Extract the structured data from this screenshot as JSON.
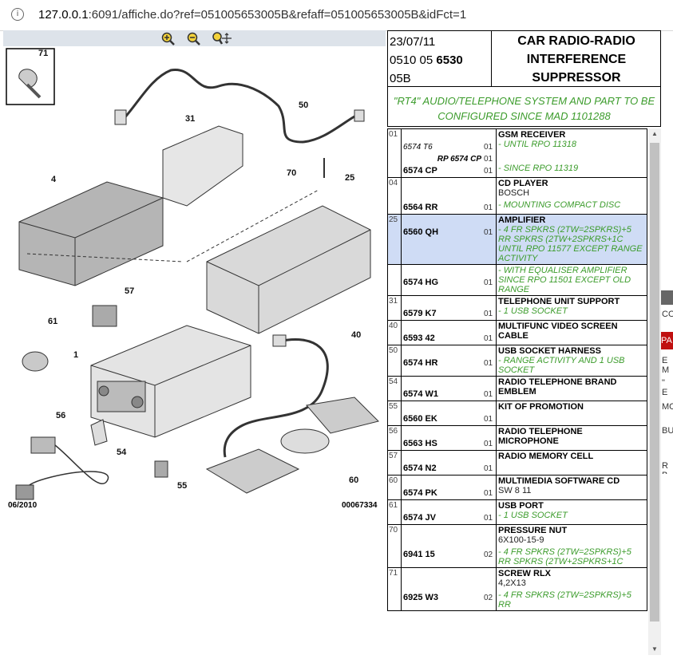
{
  "url": {
    "prefix": "127.0.0.1",
    "rest": ":6091/affiche.do?ref=051005653005B&refaff=051005653005B&idFct=1"
  },
  "header": {
    "date": "23/07/11",
    "code_a": "0510 05",
    "code_b": "6530",
    "code_c": "05B",
    "title": "CAR RADIO-RADIO INTERFERENCE SUPPRESSOR"
  },
  "config_note": "\"RT4\" AUDIO/TELEPHONE SYSTEM AND PART TO BE CONFIGURED SINCE MAD 1101288",
  "diagram": {
    "date": "06/2010",
    "ref": "00067334",
    "labels": [
      "71",
      "50",
      "31",
      "70",
      "25",
      "4",
      "57",
      "61",
      "40",
      "1",
      "56",
      "54",
      "55",
      "60"
    ]
  },
  "parts": [
    {
      "num": "01",
      "refs": [
        {
          "t": "6574 T6",
          "s": "it"
        },
        {
          "t": "RP 6574 CP",
          "s": "itb"
        },
        {
          "t": "6574 CP",
          "s": "b"
        }
      ],
      "qty": [
        "01",
        "01",
        "01"
      ],
      "name": "GSM RECEIVER",
      "lines": [
        {
          "t": "- UNTIL RPO 11318",
          "c": "g"
        },
        {
          "t": "",
          "c": "g"
        },
        {
          "t": "- SINCE RPO 11319",
          "c": "g"
        }
      ]
    },
    {
      "num": "04",
      "refs": [
        {
          "t": "6564 RR",
          "s": "b"
        }
      ],
      "qty": [
        "01"
      ],
      "name": "CD PLAYER",
      "lines": [
        {
          "t": "BOSCH",
          "c": "p"
        },
        {
          "t": "- MOUNTING COMPACT DISC",
          "c": "g"
        }
      ]
    },
    {
      "num": "25",
      "refs": [
        {
          "t": "6560 QH",
          "s": "b"
        }
      ],
      "qty": [
        "01"
      ],
      "name": "AMPLIFIER",
      "hl": true,
      "lines": [
        {
          "t": "- 4 FR SPKRS (2TW=2SPKRS)+5 RR SPKRS (2TW+2SPKRS+1C UNTIL RPO 11577 EXCEPT RANGE ACTIVITY",
          "c": "g"
        }
      ]
    },
    {
      "num": "",
      "refs": [
        {
          "t": "6574 HG",
          "s": "b"
        }
      ],
      "qty": [
        "01"
      ],
      "name": "",
      "lines": [
        {
          "t": "- WITH EQUALISER AMPLIFIER SINCE RPO 11501 EXCEPT OLD RANGE",
          "c": "g"
        }
      ]
    },
    {
      "num": "31",
      "refs": [
        {
          "t": "6579 K7",
          "s": "b"
        }
      ],
      "qty": [
        "01"
      ],
      "name": "TELEPHONE UNIT SUPPORT",
      "lines": [
        {
          "t": "- 1 USB SOCKET",
          "c": "g"
        }
      ]
    },
    {
      "num": "40",
      "refs": [
        {
          "t": "6593 42",
          "s": "b"
        }
      ],
      "qty": [
        "01"
      ],
      "name": "MULTIFUNC VIDEO SCREEN CABLE",
      "lines": []
    },
    {
      "num": "50",
      "refs": [
        {
          "t": "6574 HR",
          "s": "b"
        }
      ],
      "qty": [
        "01"
      ],
      "name": "USB SOCKET HARNESS",
      "lines": [
        {
          "t": "- RANGE ACTIVITY AND 1 USB SOCKET",
          "c": "g"
        }
      ]
    },
    {
      "num": "54",
      "refs": [
        {
          "t": "6574 W1",
          "s": "b"
        }
      ],
      "qty": [
        "01"
      ],
      "name": "RADIO TELEPHONE BRAND EMBLEM",
      "lines": []
    },
    {
      "num": "55",
      "refs": [
        {
          "t": "6560 EK",
          "s": "b"
        }
      ],
      "qty": [
        "01"
      ],
      "name": "KIT OF PROMOTION",
      "lines": []
    },
    {
      "num": "56",
      "refs": [
        {
          "t": "6563 HS",
          "s": "b"
        }
      ],
      "qty": [
        "01"
      ],
      "name": "RADIO TELEPHONE MICROPHONE",
      "lines": []
    },
    {
      "num": "57",
      "refs": [
        {
          "t": "6574 N2",
          "s": "b"
        }
      ],
      "qty": [
        "01"
      ],
      "name": "RADIO MEMORY CELL",
      "lines": []
    },
    {
      "num": "60",
      "refs": [
        {
          "t": "6574 PK",
          "s": "b"
        }
      ],
      "qty": [
        "01"
      ],
      "name": "MULTIMEDIA SOFTWARE CD",
      "lines": [
        {
          "t": "SW 8 11",
          "c": "p"
        }
      ]
    },
    {
      "num": "61",
      "refs": [
        {
          "t": "6574 JV",
          "s": "b"
        }
      ],
      "qty": [
        "01"
      ],
      "name": "USB PORT",
      "lines": [
        {
          "t": "- 1 USB SOCKET",
          "c": "g"
        }
      ]
    },
    {
      "num": "70",
      "refs": [
        {
          "t": "6941 15",
          "s": "b"
        }
      ],
      "qty": [
        "02"
      ],
      "name": "PRESSURE NUT",
      "lines": [
        {
          "t": "6X100-15-9",
          "c": "p"
        },
        {
          "t": "- 4 FR SPKRS (2TW=2SPKRS)+5 RR SPKRS (2TW+2SPKRS+1C",
          "c": "g"
        }
      ]
    },
    {
      "num": "71",
      "refs": [
        {
          "t": "6925 W3",
          "s": "b"
        }
      ],
      "qty": [
        "02"
      ],
      "name": "SCREW RLX",
      "lines": [
        {
          "t": "4,2X13",
          "c": "p"
        },
        {
          "t": "- 4 FR SPKRS (2TW=2SPKRS)+5 RR",
          "c": "g"
        }
      ]
    }
  ],
  "side_fragments": [
    "CO",
    "PA",
    "E M",
    "\" E",
    "MO",
    "BU",
    "R B"
  ]
}
